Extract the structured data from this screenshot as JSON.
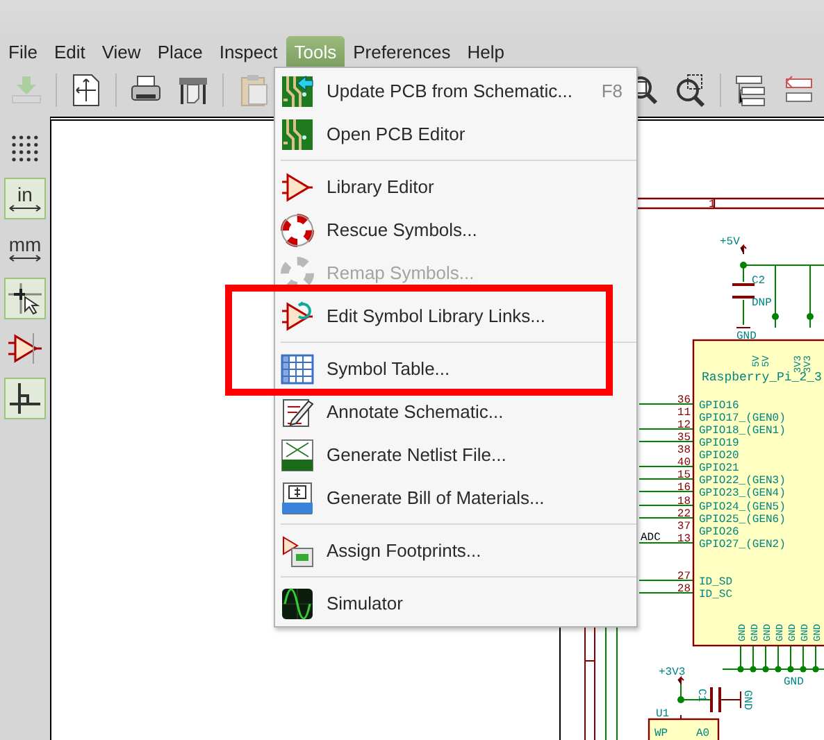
{
  "menu_bar": [
    {
      "label": "File",
      "selected": false
    },
    {
      "label": "Edit",
      "selected": false
    },
    {
      "label": "View",
      "selected": false
    },
    {
      "label": "Place",
      "selected": false
    },
    {
      "label": "Inspect",
      "selected": false
    },
    {
      "label": "Tools",
      "selected": true
    },
    {
      "label": "Preferences",
      "selected": false
    },
    {
      "label": "Help",
      "selected": false
    }
  ],
  "toolbar": [
    {
      "kind": "button",
      "disabled": true
    },
    {
      "kind": "separator"
    },
    {
      "kind": "button",
      "disabled": false
    },
    {
      "kind": "separator"
    },
    {
      "kind": "button",
      "disabled": false
    },
    {
      "kind": "button",
      "disabled": false
    },
    {
      "kind": "separator"
    },
    {
      "kind": "button",
      "disabled": true
    }
  ],
  "toolbar_right": [
    {
      "kind": "button",
      "disabled": false
    },
    {
      "kind": "button",
      "disabled": false
    },
    {
      "kind": "separator"
    },
    {
      "kind": "button",
      "disabled": false
    },
    {
      "kind": "button",
      "disabled": false
    }
  ],
  "left_toolbar": [
    {
      "kind": "grid",
      "selected": false
    },
    {
      "kind": "units",
      "label": "in",
      "selected": true
    },
    {
      "kind": "units",
      "label": "mm",
      "selected": false
    },
    {
      "kind": "cursor",
      "selected": true
    },
    {
      "kind": "pins",
      "selected": false
    },
    {
      "kind": "wire",
      "selected": true
    }
  ],
  "tools_menu": [
    {
      "kind": "item",
      "label": "Update PCB from Schematic...",
      "shortcut": "F8",
      "disabled": false
    },
    {
      "kind": "item",
      "label": "Open PCB Editor",
      "disabled": false
    },
    {
      "kind": "separator"
    },
    {
      "kind": "item",
      "label": "Library Editor",
      "disabled": false
    },
    {
      "kind": "item",
      "label": "Rescue Symbols...",
      "disabled": false
    },
    {
      "kind": "item",
      "label": "Remap Symbols...",
      "disabled": true
    },
    {
      "kind": "item",
      "label": "Edit Symbol Library Links...",
      "disabled": false
    },
    {
      "kind": "separator"
    },
    {
      "kind": "item",
      "label": "Symbol Table...",
      "disabled": false
    },
    {
      "kind": "item",
      "label": "Annotate Schematic...",
      "disabled": false
    },
    {
      "kind": "item",
      "label": "Generate Netlist File...",
      "disabled": false
    },
    {
      "kind": "item",
      "label": "Generate Bill of Materials...",
      "disabled": false
    },
    {
      "kind": "separator"
    },
    {
      "kind": "item",
      "label": "Assign Footprints...",
      "disabled": false
    },
    {
      "kind": "separator"
    },
    {
      "kind": "item",
      "label": "Simulator",
      "disabled": false
    }
  ],
  "schematic": {
    "sheet_zone": "1",
    "c2": {
      "power": "+5V",
      "reference": "C2",
      "value": "DNP",
      "ground": "GND"
    },
    "rpi": {
      "name": "Raspberry_Pi_2_3",
      "top_pins": [
        "5V",
        "5V",
        "3V3",
        "3V3"
      ],
      "pins": [
        {
          "number": "36",
          "name": "GPIO16"
        },
        {
          "number": "11",
          "name": "GPIO17_(GEN0)"
        },
        {
          "number": "12",
          "name": "GPIO18_(GEN1)"
        },
        {
          "number": "35",
          "name": "GPIO19"
        },
        {
          "number": "38",
          "name": "GPIO20"
        },
        {
          "number": "40",
          "name": "GPIO21"
        },
        {
          "number": "15",
          "name": "GPIO22_(GEN3)"
        },
        {
          "number": "16",
          "name": "GPIO23_(GEN4)"
        },
        {
          "number": "18",
          "name": "GPIO24_(GEN5)"
        },
        {
          "number": "22",
          "name": "GPIO25_(GEN6)"
        },
        {
          "number": "37",
          "name": "GPIO26"
        },
        {
          "number": "13",
          "name": "GPIO27_(GEN2)"
        },
        {
          "number": "27",
          "name": "ID_SD"
        },
        {
          "number": "28",
          "name": "ID_SC"
        }
      ],
      "bottom_pins": [
        "GND",
        "GND",
        "GND",
        "GND",
        "GND",
        "GND",
        "GND"
      ],
      "ground": "GND"
    },
    "net_label": "ADC",
    "u1": {
      "power": "+3V3",
      "cap_reference": "C1",
      "cap_ground": "GND",
      "reference": "U1",
      "pins": [
        "WP",
        "A0"
      ]
    }
  }
}
